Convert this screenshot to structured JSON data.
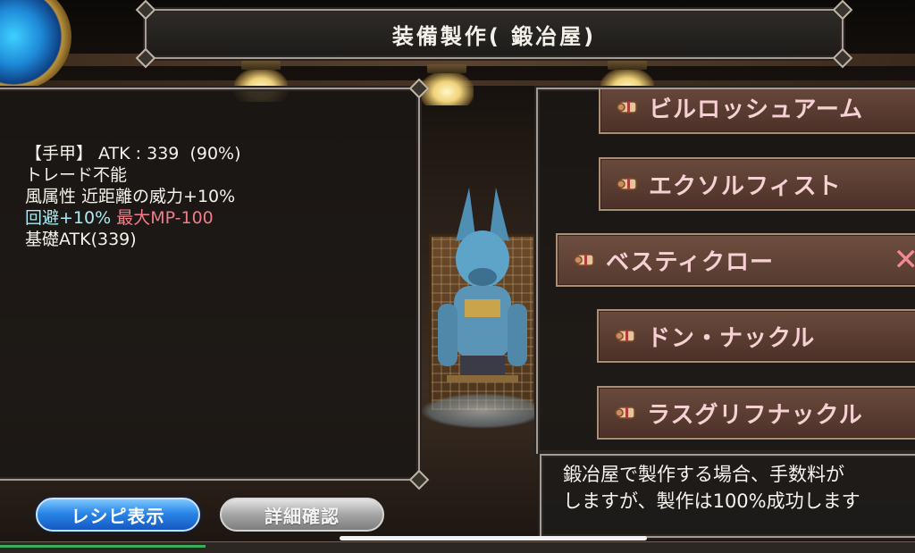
{
  "title": "装備製作( 鍛冶屋)",
  "detail": {
    "line1": "【手甲】 ATK : 339  (90%)",
    "line2": "トレード不能",
    "line3": "風属性 近距離の威力+10%",
    "line4_cyan": "回避+10%",
    "line4_pink": "最大MP-100",
    "line5": "基礎ATK(339)"
  },
  "recipes": [
    {
      "label": "ビルロッシュアーム"
    },
    {
      "label": "エクソルフィスト"
    },
    {
      "label": "ベスティクロー",
      "selected": true
    },
    {
      "label": "ドン・ナックル"
    },
    {
      "label": "ラスグリフナックル"
    }
  ],
  "remove_glyph": "✕",
  "info": {
    "line1": "鍛冶屋で製作する場合、手数料が",
    "line2": "しますが、製作は100%成功します"
  },
  "buttons": {
    "recipe": "レシピ表示",
    "detail": "詳細確認"
  },
  "icons": {
    "scroll": "scroll-icon",
    "orb": "menu-orb-icon",
    "remove": "close-icon"
  }
}
